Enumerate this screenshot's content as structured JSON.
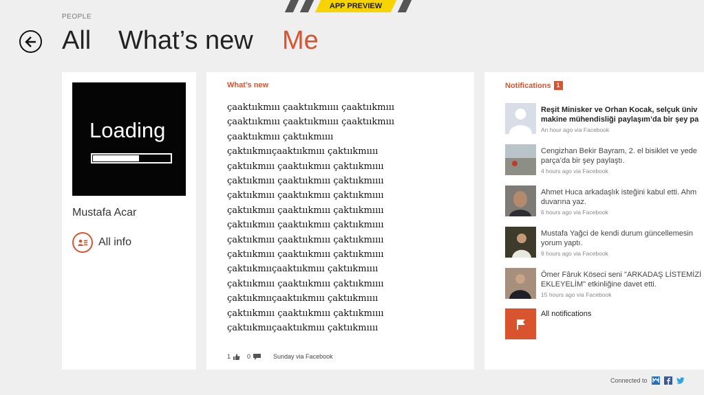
{
  "banner": {
    "label": "APP PREVIEW"
  },
  "header": {
    "section": "PEOPLE"
  },
  "pivots": [
    {
      "label": "All"
    },
    {
      "label": "What’s new"
    },
    {
      "label": "Me"
    }
  ],
  "profile": {
    "loading_text": "Loading",
    "loading_progress": 0.6,
    "name": "Mustafa Acar",
    "all_info_label": "All info"
  },
  "feed": {
    "title": "What’s new",
    "lines": [
      "çaaktııkmııı çaaktııkmıııı çaaktııkmııı",
      "çaaktııkmııı çaaktııkmıııı çaaktııkmııı",
      "çaaktııkmııı çaktııkmıııı",
      "çaktııkmııçaaktııkmııı çaktııkmıııı",
      "çaktııkmııı çaaktııkmııı çaktııkmıııı",
      "çaktııkmııı çaaktııkmııı çaktııkmıııı",
      "çaktııkmııı çaaktııkmııı çaktııkmıııı",
      "çaktııkmııı çaaktııkmııı çaktııkmıııı",
      "çaktııkmııı çaaktııkmııı çaktııkmıııı",
      "çaktııkmııı çaaktııkmııı çaktııkmıııı",
      "çaktııkmııı çaaktııkmııı çaktııkmıııı",
      "çaktııkmııçaaktııkmııı çaktııkmıııı",
      "çaktııkmııı çaaktııkmııı çaktııkmıııı",
      "çaktııkmııçaaktııkmııı çaktııkmıııı",
      "çaktııkmııı çaaktııkmııı çaktııkmıııı",
      "çaktııkmııçaaktııkmııı çaktııkmıııı"
    ],
    "likes": "1",
    "comments": "0",
    "source": "Sunday via Facebook"
  },
  "notifications": {
    "title": "Notifications",
    "count": "1",
    "items": [
      {
        "text1": "Reşit Minisker ve Orhan Kocak, selçuk üniv",
        "text2": "makine mühendisliği paylaşım’da bir şey pa",
        "meta": "An hour ago via Facebook",
        "bold": true
      },
      {
        "text1": "Cengizhan Bekir Bayram, 2. el bisiklet ve yede",
        "text2": "parça’da bir şey paylaştı.",
        "meta": "4 hours ago via Facebook",
        "bold": false
      },
      {
        "text1": "Ahmet Huca arkadaşlık isteğini kabul etti. Ahm",
        "text2": "duvarına yaz.",
        "meta": "6 hours ago via Facebook",
        "bold": false
      },
      {
        "text1": "Mustafa Yağci de kendi durum güncellemesin",
        "text2": "yorum yaptı.",
        "meta": "9 hours ago via Facebook",
        "bold": false
      },
      {
        "text1": "Ömer Fâruk Köseci seni \"ARKADAŞ LİSTEMİZİ",
        "text2": "EKLEYELİM\" etkinliğine davet etti.",
        "meta": "15 hours ago via Facebook",
        "bold": false
      }
    ],
    "all_label": "All notifications"
  },
  "footer": {
    "connected_label": "Connected to"
  },
  "colors": {
    "accent": "#d9532e",
    "banner": "#f7d400"
  }
}
